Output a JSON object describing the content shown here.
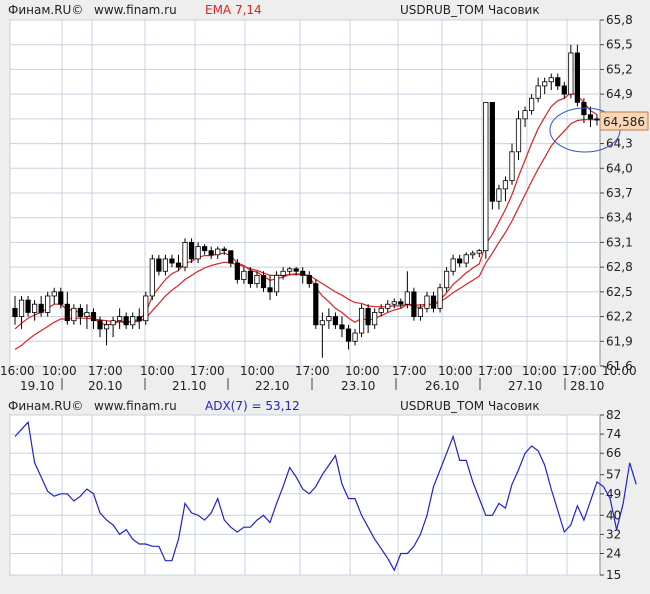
{
  "colors": {
    "background": "#eeeeee",
    "plot_bg": "#ffffff",
    "grid": "#c8d0e0",
    "candle": "#000000",
    "ema": "#dd2222",
    "adx": "#2222cc",
    "price_label_bg": "#fbd7b8",
    "circle": "#3355cc"
  },
  "price_panel": {
    "header": {
      "source": "Финам.RU©",
      "site": "www.finam.ru",
      "indicator": "EMA 7,14",
      "instrument": "USDRUB_TOM Часовик"
    },
    "last_price_label": "64,586"
  },
  "adx_panel": {
    "header": {
      "source": "Финам.RU©",
      "site": "www.finam.ru",
      "indicator": "ADX(7) = 53,12",
      "instrument": "USDRUB_TOM Часовик"
    }
  },
  "chart_data": [
    {
      "type": "candlestick",
      "title": "USDRUB_TOM Часовик",
      "indicator": "EMA 7,14",
      "y_ticks": [
        "65,8",
        "65,5",
        "65,2",
        "64,9",
        "64,6",
        "64,3",
        "64,0",
        "63,7",
        "63,4",
        "63,1",
        "62,8",
        "62,5",
        "62,2",
        "61,9",
        "61,6"
      ],
      "ylim": [
        61.6,
        65.8
      ],
      "x_time_labels": [
        "16:00",
        "10:00",
        "17:00",
        "10:00",
        "17:00",
        "10:00",
        "17:00",
        "10:00",
        "17:00",
        "10:00",
        "17:00",
        "10:00",
        "17:00",
        "10:00"
      ],
      "x_date_labels": [
        "19.10",
        "20.10",
        "21.10",
        "22.10",
        "23.10",
        "26.10",
        "27.10",
        "28.10"
      ],
      "grid": true,
      "last_price": 64.586,
      "ohlc": [
        [
          62.3,
          62.45,
          62.1,
          62.2
        ],
        [
          62.2,
          62.45,
          62.05,
          62.4
        ],
        [
          62.4,
          62.45,
          62.2,
          62.25
        ],
        [
          62.25,
          62.4,
          62.15,
          62.35
        ],
        [
          62.35,
          62.45,
          62.2,
          62.25
        ],
        [
          62.25,
          62.5,
          62.2,
          62.45
        ],
        [
          62.45,
          62.55,
          62.35,
          62.5
        ],
        [
          62.5,
          62.55,
          62.3,
          62.35
        ],
        [
          62.35,
          62.5,
          62.1,
          62.15
        ],
        [
          62.15,
          62.35,
          62.1,
          62.3
        ],
        [
          62.3,
          62.35,
          62.1,
          62.2
        ],
        [
          62.2,
          62.35,
          62.05,
          62.25
        ],
        [
          62.25,
          62.3,
          62.05,
          62.15
        ],
        [
          62.15,
          62.2,
          61.95,
          62.05
        ],
        [
          62.05,
          62.15,
          61.85,
          62.1
        ],
        [
          62.1,
          62.2,
          61.95,
          62.15
        ],
        [
          62.15,
          62.3,
          62.05,
          62.2
        ],
        [
          62.2,
          62.25,
          62.05,
          62.1
        ],
        [
          62.1,
          62.25,
          62.05,
          62.2
        ],
        [
          62.2,
          62.3,
          62.05,
          62.15
        ],
        [
          62.15,
          62.5,
          62.1,
          62.45
        ],
        [
          62.45,
          62.95,
          62.4,
          62.9
        ],
        [
          62.9,
          62.95,
          62.7,
          62.75
        ],
        [
          62.75,
          62.95,
          62.7,
          62.9
        ],
        [
          62.9,
          62.95,
          62.8,
          62.85
        ],
        [
          62.85,
          62.95,
          62.75,
          62.8
        ],
        [
          62.8,
          63.15,
          62.75,
          63.1
        ],
        [
          63.1,
          63.15,
          62.85,
          62.9
        ],
        [
          62.9,
          63.1,
          62.85,
          63.05
        ],
        [
          63.05,
          63.08,
          62.95,
          63.0
        ],
        [
          63.0,
          63.05,
          62.9,
          62.95
        ],
        [
          62.95,
          63.05,
          62.9,
          63.02
        ],
        [
          63.02,
          63.05,
          62.95,
          63.0
        ],
        [
          63.0,
          63.0,
          62.8,
          62.85
        ],
        [
          62.85,
          62.9,
          62.6,
          62.65
        ],
        [
          62.65,
          62.8,
          62.6,
          62.75
        ],
        [
          62.75,
          62.8,
          62.55,
          62.6
        ],
        [
          62.6,
          62.75,
          62.55,
          62.7
        ],
        [
          62.7,
          62.75,
          62.5,
          62.55
        ],
        [
          62.55,
          62.7,
          62.4,
          62.5
        ],
        [
          62.5,
          62.75,
          62.45,
          62.7
        ],
        [
          62.7,
          62.8,
          62.65,
          62.75
        ],
        [
          62.75,
          62.8,
          62.7,
          62.78
        ],
        [
          62.78,
          62.8,
          62.7,
          62.75
        ],
        [
          62.75,
          62.8,
          62.6,
          62.7
        ],
        [
          62.7,
          62.75,
          62.55,
          62.6
        ],
        [
          62.6,
          62.65,
          62.05,
          62.1
        ],
        [
          62.1,
          62.25,
          61.7,
          62.15
        ],
        [
          62.15,
          62.3,
          62.05,
          62.2
        ],
        [
          62.2,
          62.25,
          62.05,
          62.1
        ],
        [
          62.1,
          62.2,
          61.95,
          62.05
        ],
        [
          62.05,
          62.1,
          61.8,
          61.9
        ],
        [
          61.9,
          62.05,
          61.85,
          62.0
        ],
        [
          62.0,
          62.35,
          61.95,
          62.3
        ],
        [
          62.3,
          62.35,
          62.0,
          62.1
        ],
        [
          62.1,
          62.3,
          62.05,
          62.25
        ],
        [
          62.25,
          62.35,
          62.2,
          62.3
        ],
        [
          62.3,
          62.4,
          62.25,
          62.35
        ],
        [
          62.35,
          62.42,
          62.3,
          62.38
        ],
        [
          62.38,
          62.42,
          62.3,
          62.35
        ],
        [
          62.35,
          62.75,
          62.3,
          62.5
        ],
        [
          62.5,
          62.55,
          62.15,
          62.2
        ],
        [
          62.2,
          62.35,
          62.15,
          62.3
        ],
        [
          62.3,
          62.5,
          62.25,
          62.45
        ],
        [
          62.45,
          62.5,
          62.25,
          62.3
        ],
        [
          62.3,
          62.6,
          62.25,
          62.55
        ],
        [
          62.55,
          62.8,
          62.5,
          62.75
        ],
        [
          62.75,
          62.95,
          62.7,
          62.9
        ],
        [
          62.9,
          62.95,
          62.8,
          62.85
        ],
        [
          62.85,
          62.98,
          62.8,
          62.95
        ],
        [
          62.95,
          63.0,
          62.9,
          62.97
        ],
        [
          62.97,
          63.02,
          62.92,
          63.0
        ],
        [
          63.0,
          64.8,
          62.9,
          64.8
        ],
        [
          64.8,
          64.8,
          63.5,
          63.6
        ],
        [
          63.6,
          63.8,
          63.5,
          63.75
        ],
        [
          63.75,
          63.9,
          63.6,
          63.85
        ],
        [
          63.85,
          64.3,
          63.8,
          64.2
        ],
        [
          64.2,
          64.7,
          64.1,
          64.6
        ],
        [
          64.6,
          64.75,
          64.5,
          64.7
        ],
        [
          64.7,
          64.9,
          64.65,
          64.85
        ],
        [
          64.85,
          65.1,
          64.8,
          65.0
        ],
        [
          65.0,
          65.1,
          64.9,
          65.05
        ],
        [
          65.05,
          65.15,
          64.95,
          65.1
        ],
        [
          65.1,
          65.15,
          64.95,
          65.0
        ],
        [
          65.0,
          65.05,
          64.85,
          64.9
        ],
        [
          64.9,
          65.5,
          64.85,
          65.4
        ],
        [
          65.4,
          65.5,
          64.75,
          64.8
        ],
        [
          64.8,
          64.85,
          64.55,
          64.65
        ],
        [
          64.65,
          64.75,
          64.5,
          64.6
        ],
        [
          64.6,
          64.65,
          64.52,
          64.586
        ]
      ],
      "ema_fast": [
        62.05,
        62.12,
        62.18,
        62.22,
        62.25,
        62.3,
        62.35,
        62.35,
        62.28,
        62.28,
        62.24,
        62.22,
        62.18,
        62.12,
        62.1,
        62.11,
        62.14,
        62.12,
        62.15,
        62.16,
        62.25,
        62.45,
        62.55,
        62.65,
        62.72,
        62.76,
        62.85,
        62.87,
        62.92,
        62.94,
        62.94,
        62.96,
        62.97,
        62.94,
        62.85,
        62.82,
        62.76,
        62.74,
        62.69,
        62.64,
        62.66,
        62.68,
        62.71,
        62.72,
        62.71,
        62.69,
        62.55,
        62.45,
        62.38,
        62.3,
        62.25,
        62.18,
        62.13,
        62.18,
        62.15,
        62.18,
        62.21,
        62.25,
        62.28,
        62.3,
        62.35,
        62.32,
        62.31,
        62.35,
        62.34,
        62.4,
        62.49,
        62.59,
        62.66,
        62.73,
        62.79,
        62.84,
        63.08,
        63.2,
        63.35,
        63.5,
        63.68,
        63.9,
        64.1,
        64.3,
        64.48,
        64.62,
        64.75,
        64.82,
        64.85,
        64.92,
        64.88,
        64.8,
        64.7,
        64.65
      ],
      "ema_slow": [
        61.8,
        61.85,
        61.92,
        61.98,
        62.03,
        62.08,
        62.13,
        62.17,
        62.17,
        62.18,
        62.18,
        62.18,
        62.17,
        62.16,
        62.15,
        62.14,
        62.14,
        62.14,
        62.14,
        62.14,
        62.18,
        62.27,
        62.36,
        62.45,
        62.52,
        62.58,
        62.65,
        62.7,
        62.75,
        62.79,
        62.82,
        62.84,
        62.86,
        62.85,
        62.83,
        62.81,
        62.78,
        62.76,
        62.73,
        62.7,
        62.7,
        62.7,
        62.71,
        62.71,
        62.71,
        62.7,
        62.65,
        62.6,
        62.55,
        62.5,
        62.46,
        62.41,
        62.37,
        62.36,
        62.33,
        62.32,
        62.32,
        62.32,
        62.33,
        62.33,
        62.35,
        62.34,
        62.34,
        62.35,
        62.35,
        62.38,
        62.43,
        62.49,
        62.54,
        62.59,
        62.64,
        62.69,
        62.85,
        62.97,
        63.1,
        63.22,
        63.36,
        63.52,
        63.68,
        63.84,
        63.99,
        64.13,
        64.27,
        64.37,
        64.45,
        64.54,
        64.58,
        64.59,
        64.59,
        64.59
      ]
    },
    {
      "type": "line",
      "title": "USDRUB_TOM Часовик",
      "indicator": "ADX(7) = 53,12",
      "y_ticks": [
        "82",
        "74",
        "66",
        "57",
        "49",
        "40",
        "32",
        "24",
        "15"
      ],
      "ylim": [
        15,
        82
      ],
      "grid": true,
      "series": [
        {
          "name": "ADX(7) = 53,12",
          "values": [
            73,
            76,
            79,
            62,
            56,
            50,
            48,
            49,
            49,
            46,
            48,
            51,
            49,
            41,
            38,
            36,
            32,
            34,
            30,
            28,
            28,
            27,
            27,
            21,
            21,
            30,
            45,
            41,
            40,
            38,
            41,
            47,
            38,
            35,
            33,
            35,
            35,
            38,
            40,
            37,
            45,
            52,
            60,
            56,
            51,
            49,
            52,
            57,
            61,
            65,
            53,
            47,
            47,
            40,
            35,
            30,
            26,
            22,
            17,
            24,
            24,
            27,
            32,
            40,
            52,
            59,
            66,
            73,
            63,
            63,
            54,
            47,
            40,
            40,
            45,
            43,
            53,
            59,
            66,
            69,
            67,
            61,
            51,
            42,
            33,
            36,
            44,
            38,
            46,
            54,
            52,
            47,
            34,
            45,
            62,
            53
          ]
        }
      ]
    }
  ]
}
